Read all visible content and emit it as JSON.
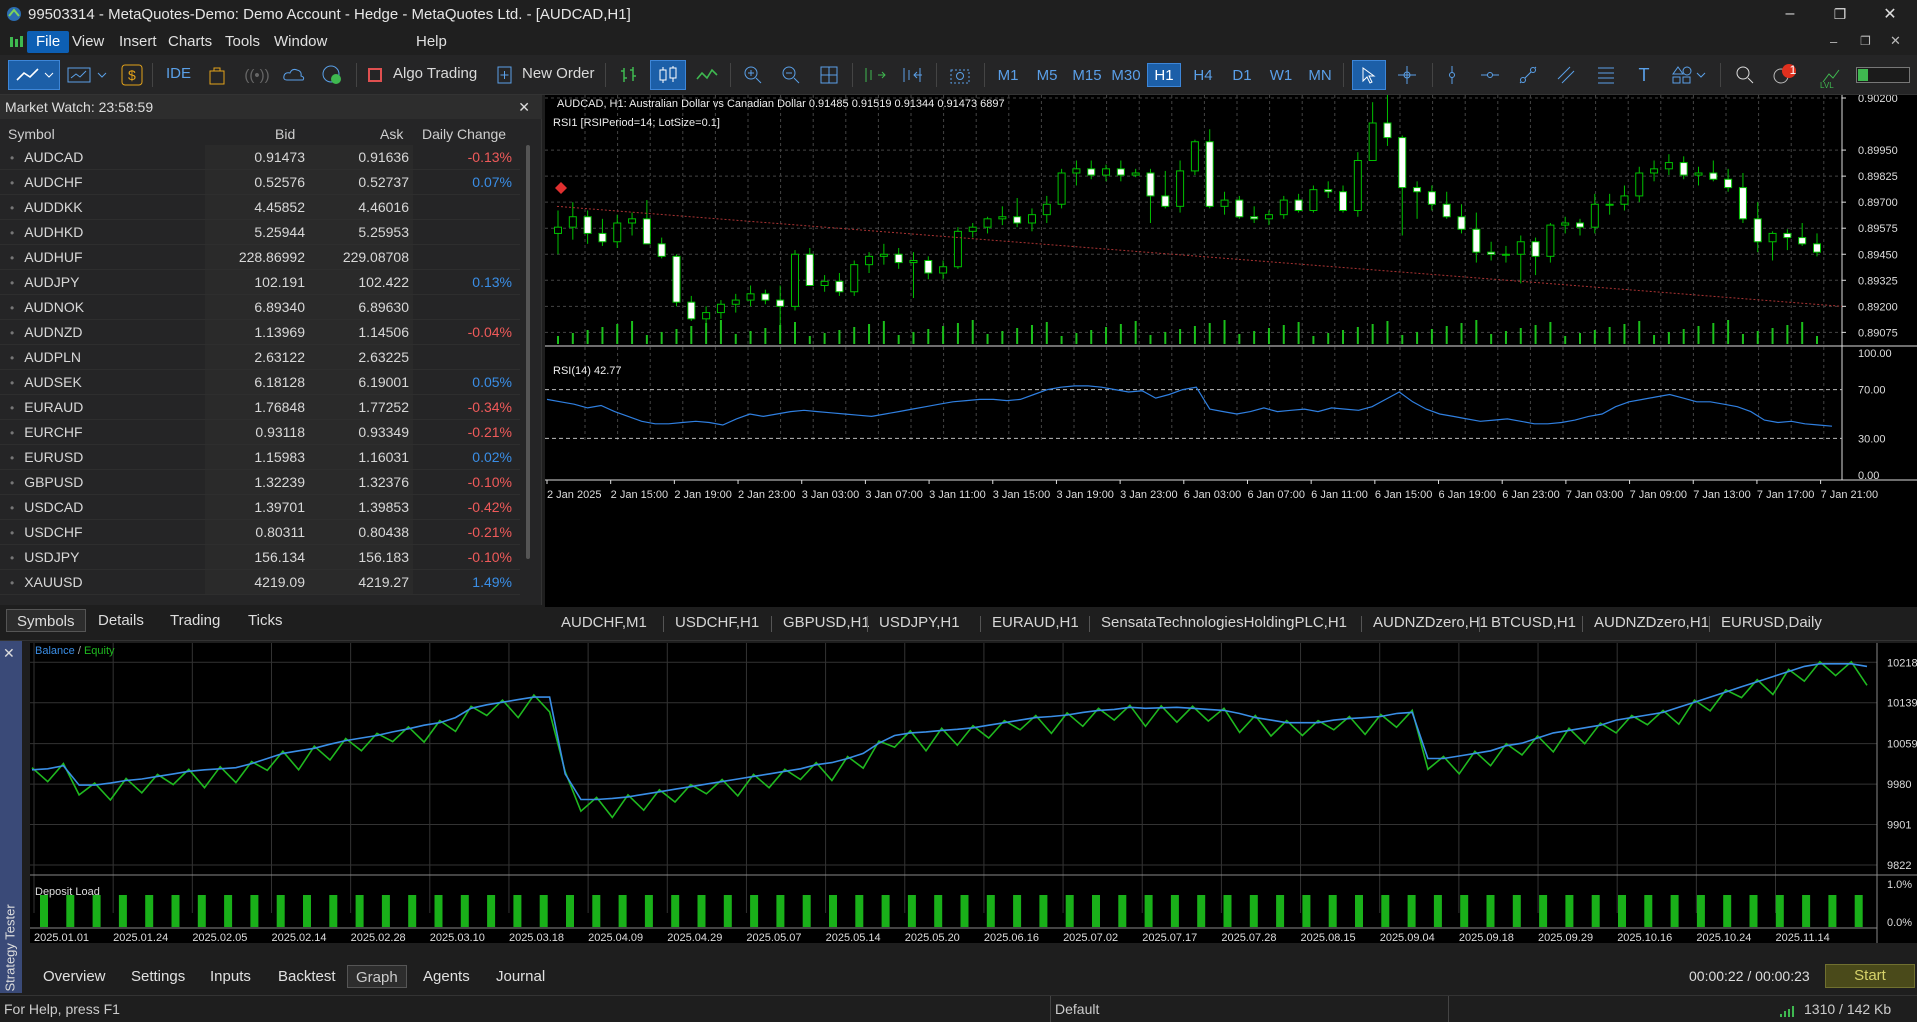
{
  "window": {
    "title": "99503314 - MetaQuotes-Demo: Demo Account - Hedge - MetaQuotes Ltd. - [AUDCAD,H1]",
    "minimize": "–",
    "restore": "❐",
    "close": "✕"
  },
  "menu": [
    "File",
    "View",
    "Insert",
    "Charts",
    "Tools",
    "Window",
    "Help"
  ],
  "toolbar": {
    "ide": "IDE",
    "algo_trading": "Algo Trading",
    "new_order": "New Order",
    "timeframes": [
      "M1",
      "M5",
      "M15",
      "M30",
      "H1",
      "H4",
      "D1",
      "W1",
      "MN"
    ],
    "selected_timeframe": "H1",
    "notification_count": "1",
    "lvl": "LVL"
  },
  "market_watch": {
    "title": "Market Watch: 23:58:59",
    "columns": [
      "Symbol",
      "Bid",
      "Ask",
      "Daily Change"
    ],
    "rows": [
      {
        "symbol": "AUDCAD",
        "bid": "0.91473",
        "ask": "0.91636",
        "change": "-0.13%"
      },
      {
        "symbol": "AUDCHF",
        "bid": "0.52576",
        "ask": "0.52737",
        "change": "0.07%"
      },
      {
        "symbol": "AUDDKK",
        "bid": "4.45852",
        "ask": "4.46016",
        "change": ""
      },
      {
        "symbol": "AUDHKD",
        "bid": "5.25944",
        "ask": "5.25953",
        "change": ""
      },
      {
        "symbol": "AUDHUF",
        "bid": "228.86992",
        "ask": "229.08708",
        "change": ""
      },
      {
        "symbol": "AUDJPY",
        "bid": "102.191",
        "ask": "102.422",
        "change": "0.13%"
      },
      {
        "symbol": "AUDNOK",
        "bid": "6.89340",
        "ask": "6.89630",
        "change": ""
      },
      {
        "symbol": "AUDNZD",
        "bid": "1.13969",
        "ask": "1.14506",
        "change": "-0.04%"
      },
      {
        "symbol": "AUDPLN",
        "bid": "2.63122",
        "ask": "2.63225",
        "change": ""
      },
      {
        "symbol": "AUDSEK",
        "bid": "6.18128",
        "ask": "6.19001",
        "change": "0.05%"
      },
      {
        "symbol": "EURAUD",
        "bid": "1.76848",
        "ask": "1.77252",
        "change": "-0.34%"
      },
      {
        "symbol": "EURCHF",
        "bid": "0.93118",
        "ask": "0.93349",
        "change": "-0.21%"
      },
      {
        "symbol": "EURUSD",
        "bid": "1.15983",
        "ask": "1.16031",
        "change": "0.02%"
      },
      {
        "symbol": "GBPUSD",
        "bid": "1.32239",
        "ask": "1.32376",
        "change": "-0.10%"
      },
      {
        "symbol": "USDCAD",
        "bid": "1.39701",
        "ask": "1.39853",
        "change": "-0.42%"
      },
      {
        "symbol": "USDCHF",
        "bid": "0.80311",
        "ask": "0.80438",
        "change": "-0.21%"
      },
      {
        "symbol": "USDJPY",
        "bid": "156.134",
        "ask": "156.183",
        "change": "-0.10%"
      },
      {
        "symbol": "XAUUSD",
        "bid": "4219.09",
        "ask": "4219.27",
        "change": "1.49%"
      }
    ],
    "tabs": [
      "Symbols",
      "Details",
      "Trading",
      "Ticks"
    ]
  },
  "chart": {
    "header": "AUDCAD, H1:  Australian Dollar vs Canadian Dollar  0.91485 0.91519 0.91344 0.91473  6897",
    "indicator": "RSI1 [RSIPeriod=14; LotSize=0.1]",
    "rsi_label": "RSI(14) 42.77",
    "price_ticks": [
      "0.90200",
      "0.89950",
      "0.89825",
      "0.89700",
      "0.89575",
      "0.89450",
      "0.89325",
      "0.89200",
      "0.89075"
    ],
    "rsi_ticks": [
      "100.00",
      "70.00",
      "30.00",
      "0.00"
    ],
    "time_labels": [
      "2 Jan 2025",
      "2 Jan 15:00",
      "2 Jan 19:00",
      "2 Jan 23:00",
      "3 Jan 03:00",
      "3 Jan 07:00",
      "3 Jan 11:00",
      "3 Jan 15:00",
      "3 Jan 19:00",
      "3 Jan 23:00",
      "6 Jan 03:00",
      "6 Jan 07:00",
      "6 Jan 11:00",
      "6 Jan 15:00",
      "6 Jan 19:00",
      "6 Jan 23:00",
      "7 Jan 03:00",
      "7 Jan 09:00",
      "7 Jan 13:00",
      "7 Jan 17:00",
      "7 Jan 21:00"
    ]
  },
  "chart_tabs": [
    "AUDCHF,M1",
    "USDCHF,H1",
    "GBPUSD,H1",
    "USDJPY,H1",
    "EURAUD,H1",
    "SensataTechnologiesHoldingPLC,H1",
    "AUDNZDzero,H1",
    "BTCUSD,H1",
    "AUDNZDzero,H1",
    "EURUSD,Daily"
  ],
  "tester": {
    "side_label": "Strategy Tester",
    "legend_balance": "Balance",
    "legend_sep": " / ",
    "legend_equity": "Equity",
    "y_ticks": [
      "10218",
      "10139",
      "10059",
      "9980",
      "9901",
      "9822"
    ],
    "deposit_load": "Deposit Load",
    "load_ticks": [
      "1.0%",
      "0.0%"
    ],
    "dates": [
      "2025.01.01",
      "2025.01.24",
      "2025.02.05",
      "2025.02.14",
      "2025.02.28",
      "2025.03.10",
      "2025.03.18",
      "2025.04.09",
      "2025.04.29",
      "2025.05.07",
      "2025.05.14",
      "2025.05.20",
      "2025.06.16",
      "2025.07.02",
      "2025.07.17",
      "2025.07.28",
      "2025.08.15",
      "2025.09.04",
      "2025.09.18",
      "2025.09.29",
      "2025.10.16",
      "2025.10.24",
      "2025.11.14"
    ],
    "tabs": [
      "Overview",
      "Settings",
      "Inputs",
      "Backtest",
      "Graph",
      "Agents",
      "Journal"
    ],
    "timer": "00:00:22 / 00:00:23",
    "start": "Start"
  },
  "status": {
    "help": "For Help, press F1",
    "profile": "Default",
    "traffic": "1310 / 142 Kb"
  },
  "colors": {
    "bull": "#00b300",
    "bear": "#ffffff",
    "rsi": "#2f7fe0",
    "balance": "#3a8ee6",
    "equity": "#1fb81f",
    "grid": "#555"
  }
}
